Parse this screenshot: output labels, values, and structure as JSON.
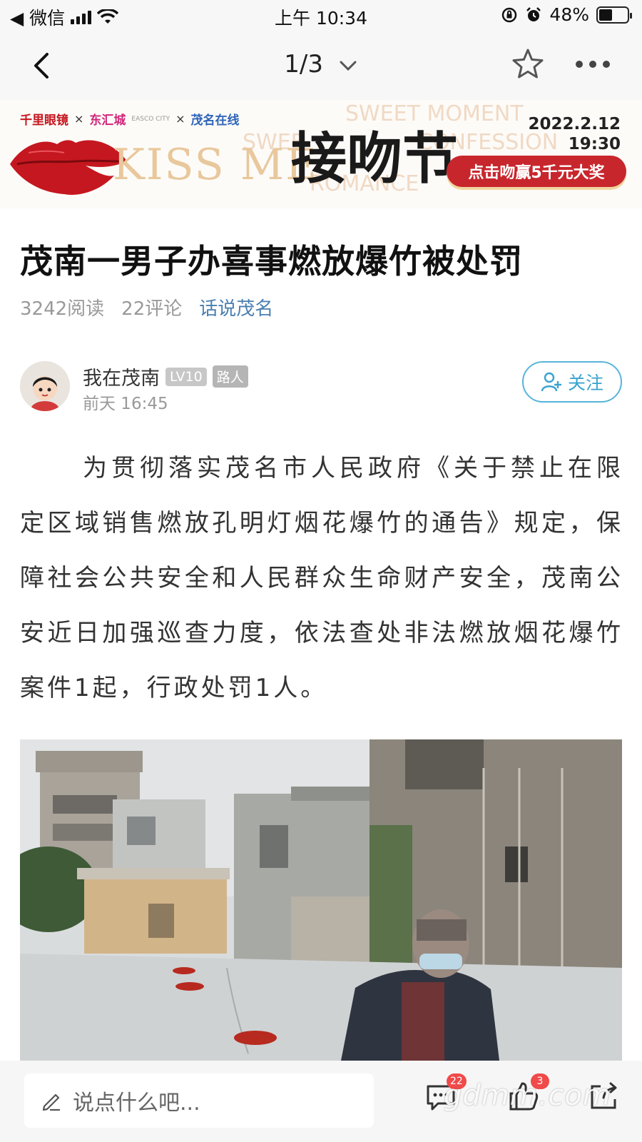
{
  "status_bar": {
    "back_app": "◀ 微信",
    "time": "上午 10:34",
    "battery": "48%",
    "battery_level": 0.48
  },
  "nav": {
    "page_indicator": "1/3"
  },
  "banner": {
    "sponsor_1": "千里眼镜",
    "sponsor_2": "东汇城",
    "sponsor_2_sub": "EASCO CITY",
    "sponsor_3": "茂名在线",
    "times": "×",
    "kiss_me": "KISS ME",
    "event": "接吻节",
    "ghost_1": "SWEET MOMENT",
    "ghost_2": "CONFESSION",
    "ghost_3": "ROMANCE",
    "ghost_4": "SWEE",
    "date": "2022.2.12",
    "time": "19:30",
    "cta": "点击吻赢5千元大奖"
  },
  "article": {
    "title": "茂南一男子办喜事燃放爆竹被处罚",
    "reads": "3242阅读",
    "comments": "22评论",
    "topic": "话说茂名",
    "body": "为贯彻落实茂名市人民政府《关于禁止在限定区域销售燃放孔明灯烟花爆竹的通告》规定，保障社会公共安全和人民群众生命财产安全，茂南公安近日加强巡查力度，依法查处非法燃放烟花爆竹案件1起，行政处罚1人。"
  },
  "author": {
    "name": "我在茂南",
    "level": "LV10",
    "role": "路人",
    "time": "前天 16:45",
    "follow_label": "关注"
  },
  "bottom_bar": {
    "comment_placeholder": "说点什么吧...",
    "comment_badge": "22",
    "like_badge": "3"
  },
  "watermark": "gdmm.com",
  "colors": {
    "accent": "#3aa3cf",
    "topic": "#4a7fb0",
    "cta": "#c8262d",
    "badge": "#f04a4a"
  }
}
